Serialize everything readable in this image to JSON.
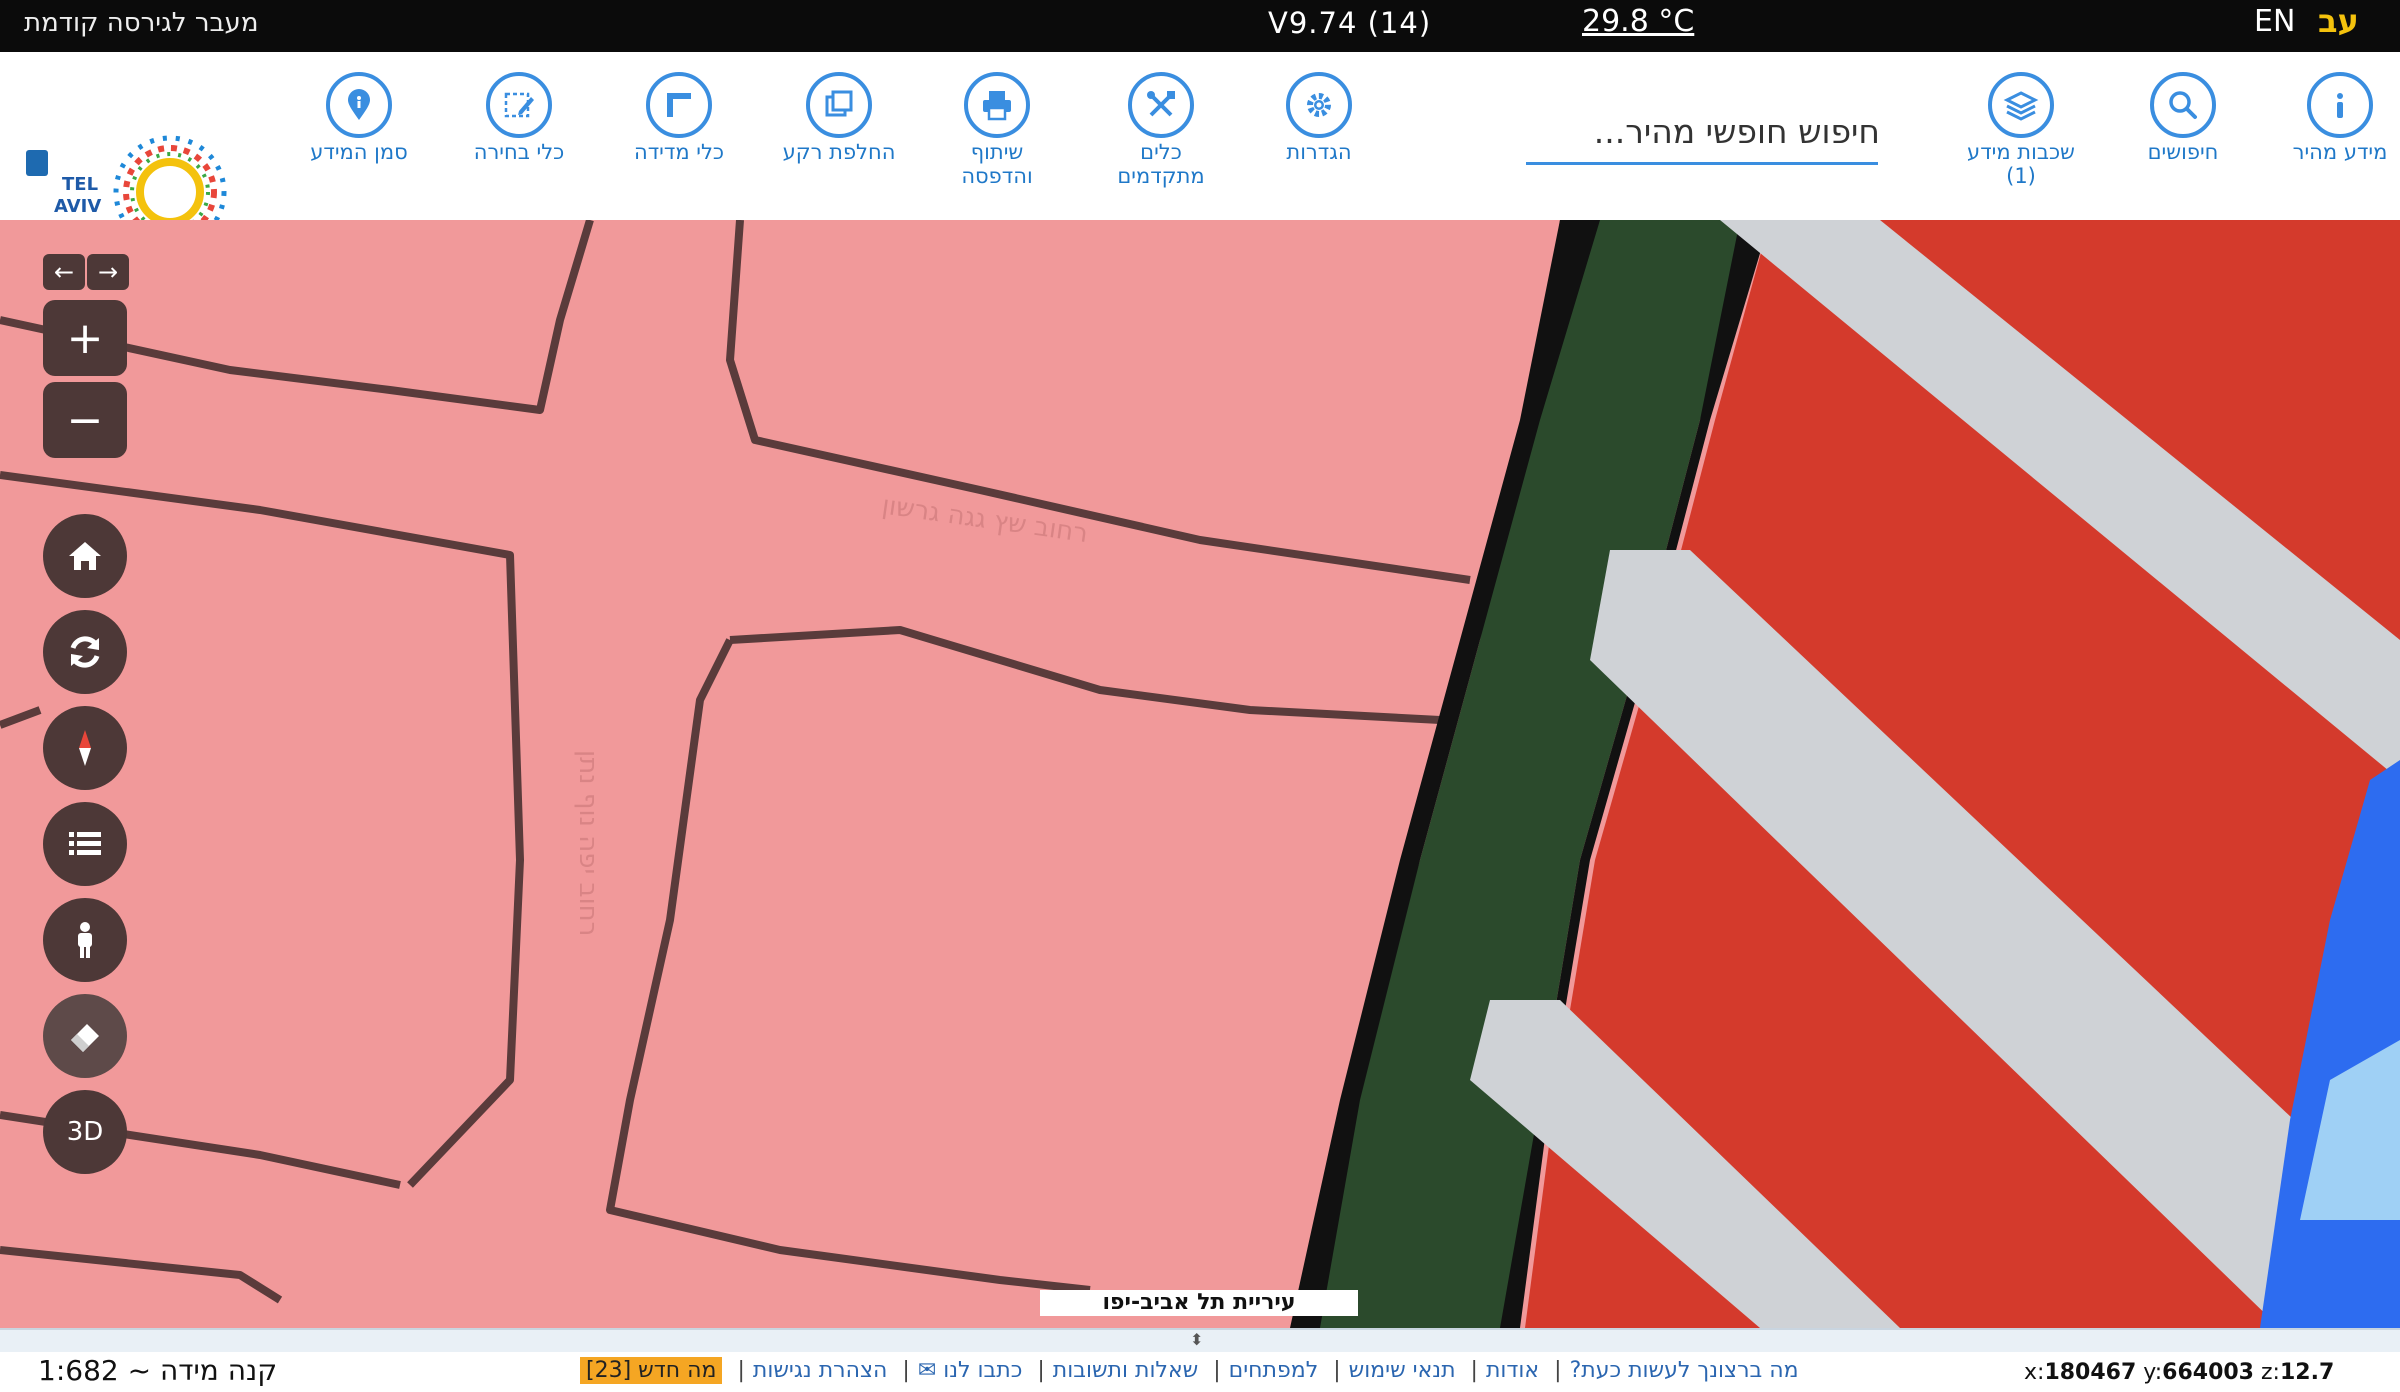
{
  "topbar": {
    "prev_version": "מעבר לגירסה קודמת",
    "version": "V9.74 (14)",
    "temperature": "29.8 °C",
    "lang_en": "EN",
    "lang_he": "עב"
  },
  "toolbar": {
    "search_placeholder": "חיפוש חופשי מהיר...",
    "tools": [
      {
        "label": "מידע מהיר",
        "icon": "info-icon"
      },
      {
        "label": "חיפושים",
        "icon": "search-icon"
      },
      {
        "label": "שכבות מידע",
        "sub": "(1)",
        "icon": "layers-icon"
      },
      {
        "label": "הגדרות",
        "icon": "gear-icon"
      },
      {
        "label": "כלים",
        "sub": "מתקדמים",
        "icon": "tools-icon"
      },
      {
        "label": "שיתוף",
        "sub": "והדפסה",
        "icon": "printer-icon"
      },
      {
        "label": "החלפת רקע",
        "icon": "basemap-icon"
      },
      {
        "label": "כלי מדידה",
        "icon": "ruler-icon"
      },
      {
        "label": "כלי בחירה",
        "icon": "select-icon"
      },
      {
        "label": "סמן המידע",
        "icon": "pin-icon"
      }
    ],
    "logo_text": "TEL AVIV YAFO תל אביב יפו"
  },
  "map": {
    "city_label": "עיריית תל אביב-יפו",
    "street_1": "רחוב שץ גגה גרשון",
    "street_2": "רחוב יפה נוף נתן",
    "controls": {
      "zoom_in": "+",
      "zoom_out": "−",
      "three_d": "3D"
    }
  },
  "bottombar": {
    "scale": "קנה מידה ~ 1:682",
    "links": [
      "מה ברצונך לעשות כעת?",
      "אודות",
      "תנאי שימוש",
      "למפתחים",
      "שאלות ותשובות",
      "כתבו לנו ✉",
      "הצהרת נגישות"
    ],
    "whats_new": "מה חדש [23]",
    "coord_x_label": "x:",
    "coord_x": "180467",
    "coord_y_label": "y:",
    "coord_y": "664003",
    "coord_z_label": "z:",
    "coord_z": "12.7"
  },
  "colors": {
    "accent": "#3a8ee0",
    "map_pink": "#f1999a",
    "map_red": "#d43a2c",
    "map_green": "#2b4a2c",
    "control_brown": "#4d3837"
  }
}
